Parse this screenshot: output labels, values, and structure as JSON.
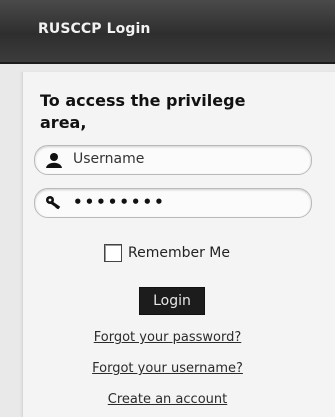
{
  "window": {
    "title": "RUSCCP Login"
  },
  "form": {
    "heading": "To access the privilege area,",
    "username_placeholder": "Username",
    "password_value": "••••••••",
    "remember_label": "Remember Me",
    "remember_checked": false,
    "login_label": "Login",
    "links": [
      "Forgot your password?",
      "Forgot your username?",
      "Create an account"
    ]
  },
  "icons": {
    "username": "user-icon",
    "password": "key-icon"
  },
  "colors": {
    "header_bg": "#2e2e2e",
    "panel_bg": "#f4f4f4",
    "button_bg": "#1c1c1c"
  }
}
